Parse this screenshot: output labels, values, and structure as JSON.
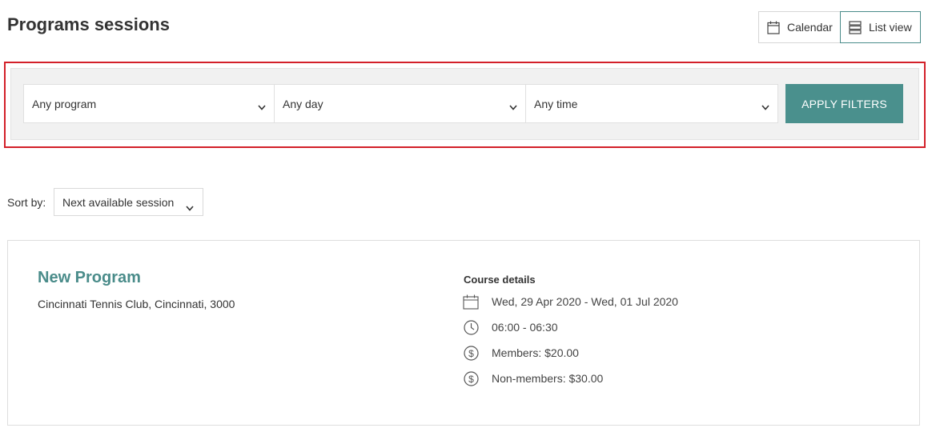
{
  "header": {
    "title": "Programs sessions",
    "view_toggle": {
      "calendar_label": "Calendar",
      "list_label": "List view",
      "active": "list"
    }
  },
  "filters": {
    "program": "Any program",
    "day": "Any day",
    "time": "Any time",
    "apply_label": "APPLY FILTERS"
  },
  "sort": {
    "label": "Sort by:",
    "value": "Next available session"
  },
  "results": [
    {
      "name": "New Program",
      "location": "Cincinnati Tennis Club, Cincinnati, 3000",
      "details_heading": "Course details",
      "dates": "Wed, 29 Apr 2020 - Wed, 01 Jul 2020",
      "time": "06:00 - 06:30",
      "members_price": "Members: $20.00",
      "nonmembers_price": "Non-members: $30.00"
    }
  ],
  "icons": {
    "calendar": "calendar-icon",
    "list": "list-icon",
    "chevron": "chevron-down-icon",
    "clock": "clock-icon",
    "dollar": "dollar-icon"
  },
  "colors": {
    "accent": "#4a908d",
    "highlight_border": "#d32029",
    "panel_bg": "#f1f1f1"
  }
}
